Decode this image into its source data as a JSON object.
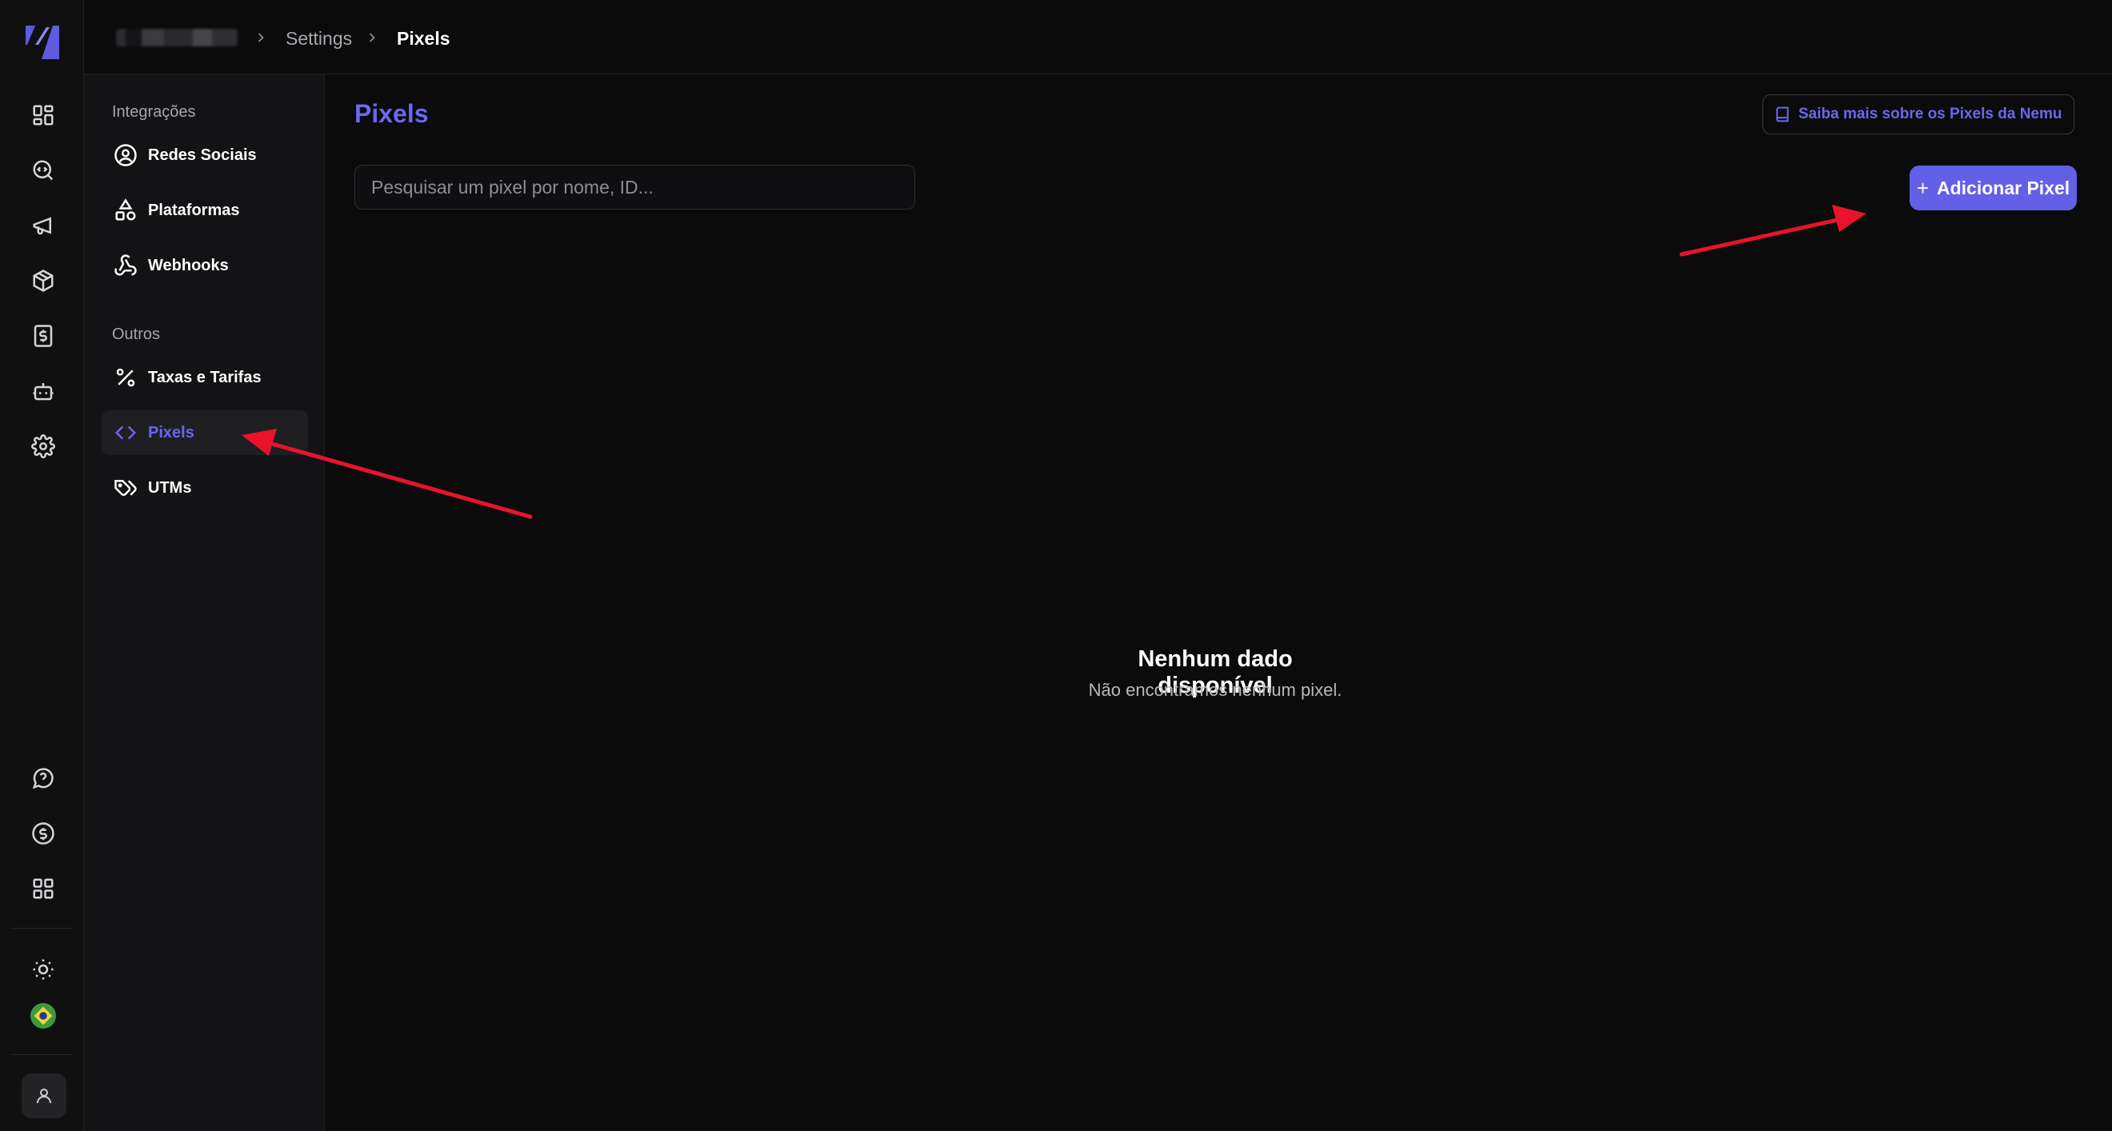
{
  "breadcrumb": {
    "settings": "Settings",
    "current": "Pixels"
  },
  "sidebar": {
    "sections": [
      {
        "title": "Integrações",
        "items": [
          {
            "label": "Redes Sociais",
            "icon": "user-circle-icon"
          },
          {
            "label": "Plataformas",
            "icon": "shapes-icon"
          },
          {
            "label": "Webhooks",
            "icon": "webhook-icon"
          }
        ]
      },
      {
        "title": "Outros",
        "items": [
          {
            "label": "Taxas e Tarifas",
            "icon": "percent-icon"
          },
          {
            "label": "Pixels",
            "icon": "code-icon",
            "active": true
          },
          {
            "label": "UTMs",
            "icon": "tags-icon"
          }
        ]
      }
    ]
  },
  "rail": {
    "top_icons": [
      "dashboard-icon",
      "search-code-icon",
      "megaphone-icon",
      "package-icon",
      "receipt-dollar-icon",
      "bot-icon",
      "settings-icon"
    ],
    "bottom_icons": [
      "help-icon",
      "dollar-coin-icon",
      "apps-grid-icon",
      "sun-icon",
      "brazil-flag-icon",
      "user-icon"
    ]
  },
  "main": {
    "title": "Pixels",
    "docs_link": "Saiba mais sobre os Pixels da Nemu",
    "search_placeholder": "Pesquisar um pixel por nome, ID...",
    "add_button": "Adicionar Pixel",
    "empty_title": "Nenhum dado disponível",
    "empty_subtitle": "Não encontramos nenhum pixel."
  },
  "colors": {
    "accent": "#6360e8",
    "annotation_arrow": "#e8132a",
    "background": "#0b0b0c"
  }
}
